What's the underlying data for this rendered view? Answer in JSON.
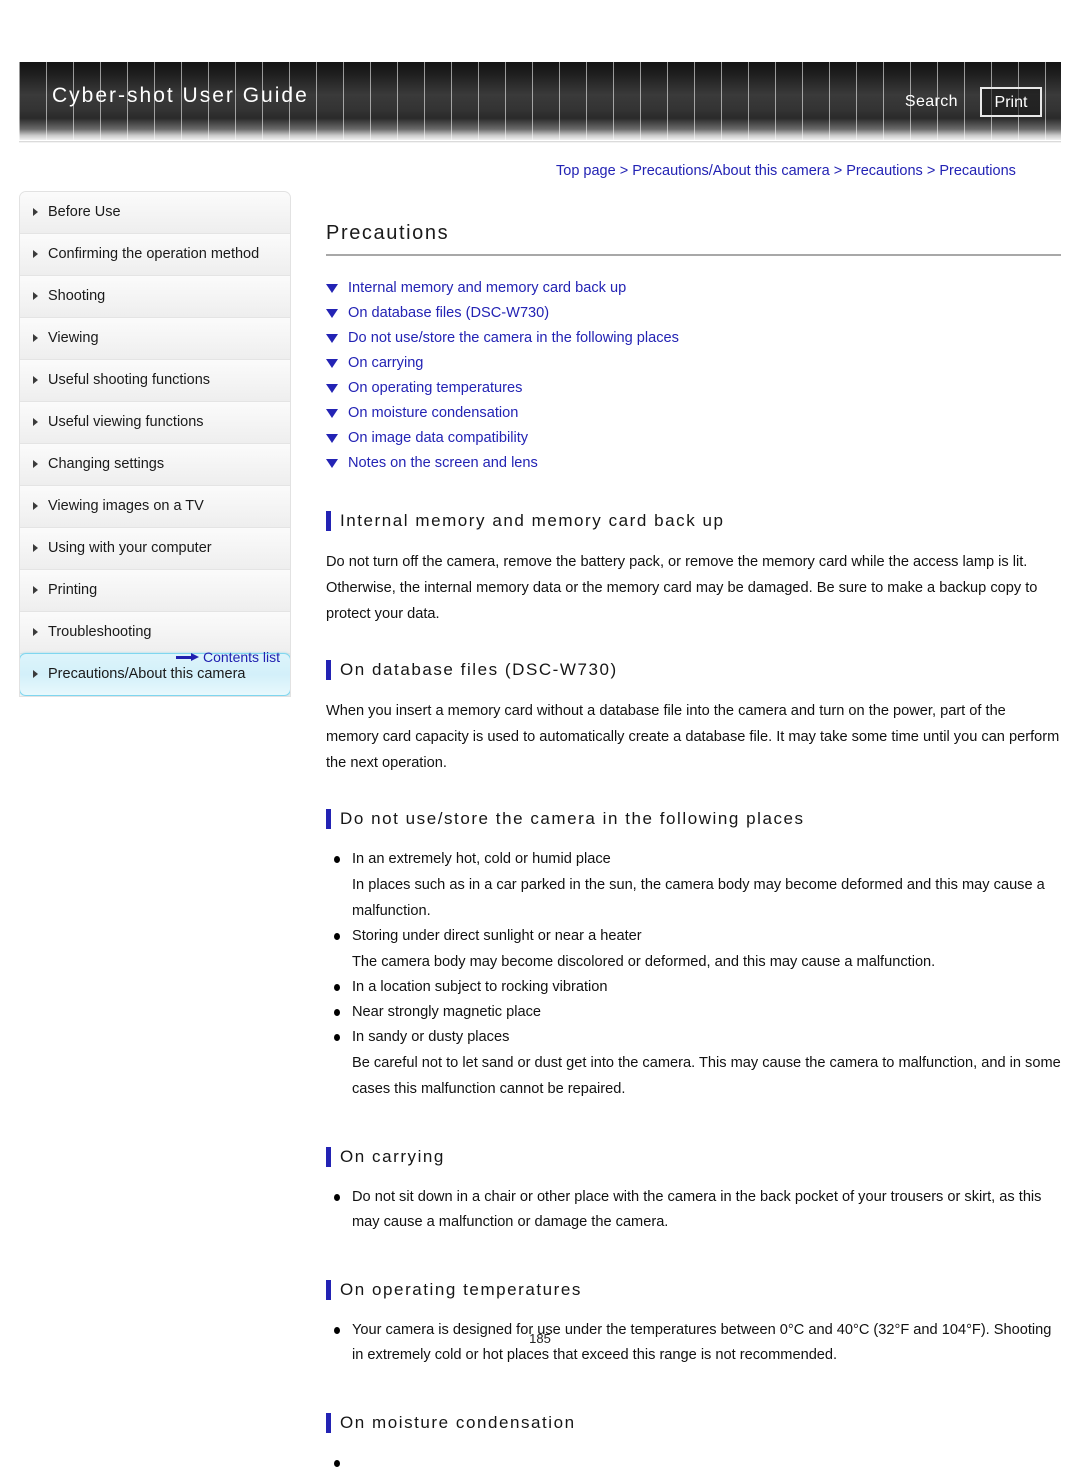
{
  "header": {
    "brand": "Cyber-shot User Guide",
    "search_label": "Search",
    "print_label": "Print"
  },
  "sidebar": {
    "items": [
      {
        "label": "Before Use",
        "active": false
      },
      {
        "label": "Confirming the operation method",
        "active": false
      },
      {
        "label": "Shooting",
        "active": false
      },
      {
        "label": "Viewing",
        "active": false
      },
      {
        "label": "Useful shooting functions",
        "active": false
      },
      {
        "label": "Useful viewing functions",
        "active": false
      },
      {
        "label": "Changing settings",
        "active": false
      },
      {
        "label": "Viewing images on a TV",
        "active": false
      },
      {
        "label": "Using with your computer",
        "active": false
      },
      {
        "label": "Printing",
        "active": false
      },
      {
        "label": "Troubleshooting",
        "active": false
      },
      {
        "label": "Precautions/About this camera",
        "active": true
      }
    ],
    "contents_list_label": "Contents list"
  },
  "breadcrumb": {
    "items": [
      "Top page",
      "Precautions/About this camera",
      "Precautions",
      "Precautions"
    ],
    "separator": ">"
  },
  "main": {
    "title": "Precautions",
    "anchors": [
      "Internal memory and memory card back up",
      "On database files (DSC-W730)",
      "Do not use/store the camera in the following places",
      "On carrying",
      "On operating temperatures",
      "On moisture condensation",
      "On image data compatibility",
      "Notes on the screen and lens"
    ],
    "sections": [
      {
        "heading": "Internal memory and memory card back up",
        "paragraph": "Do not turn off the camera, remove the battery pack, or remove the memory card while the access lamp is lit. Otherwise, the internal memory data or the memory card may be damaged. Be sure to make a backup copy to protect your data.",
        "bullets": []
      },
      {
        "heading": "On database files (DSC-W730)",
        "paragraph": "When you insert a memory card without a database file into the camera and turn on the power, part of the memory card capacity is used to automatically create a database file. It may take some time until you can perform the next operation.",
        "bullets": []
      },
      {
        "heading": "Do not use/store the camera in the following places",
        "paragraph": "",
        "bullets": [
          {
            "text": "In an extremely hot, cold or humid place",
            "sub": "In places such as in a car parked in the sun, the camera body may become deformed and this may cause a malfunction."
          },
          {
            "text": "Storing under direct sunlight or near a heater",
            "sub": "The camera body may become discolored or deformed, and this may cause a malfunction."
          },
          {
            "text": "In a location subject to rocking vibration",
            "sub": ""
          },
          {
            "text": "Near strongly magnetic place",
            "sub": ""
          },
          {
            "text": "In sandy or dusty places",
            "sub": "Be careful not to let sand or dust get into the camera. This may cause the camera to malfunction, and in some cases this malfunction cannot be repaired."
          }
        ]
      },
      {
        "heading": "On carrying",
        "paragraph": "",
        "bullets": [
          {
            "text": "Do not sit down in a chair or other place with the camera in the back pocket of your trousers or skirt, as this may cause a malfunction or damage the camera.",
            "sub": ""
          }
        ]
      },
      {
        "heading": "On operating temperatures",
        "paragraph": "",
        "bullets": [
          {
            "text": "Your camera is designed for use under the temperatures between 0°C and 40°C (32°F and 104°F). Shooting in extremely cold or hot places that exceed this range is not recommended.",
            "sub": ""
          }
        ]
      },
      {
        "heading": "On moisture condensation",
        "paragraph": "",
        "bullets": [
          {
            "text": "",
            "sub": ""
          }
        ]
      }
    ]
  },
  "footer": {
    "page_number": "185"
  },
  "colors": {
    "link": "#2323b4",
    "accent_bar": "#2323b4",
    "active_item_border": "#7fd6ef"
  }
}
